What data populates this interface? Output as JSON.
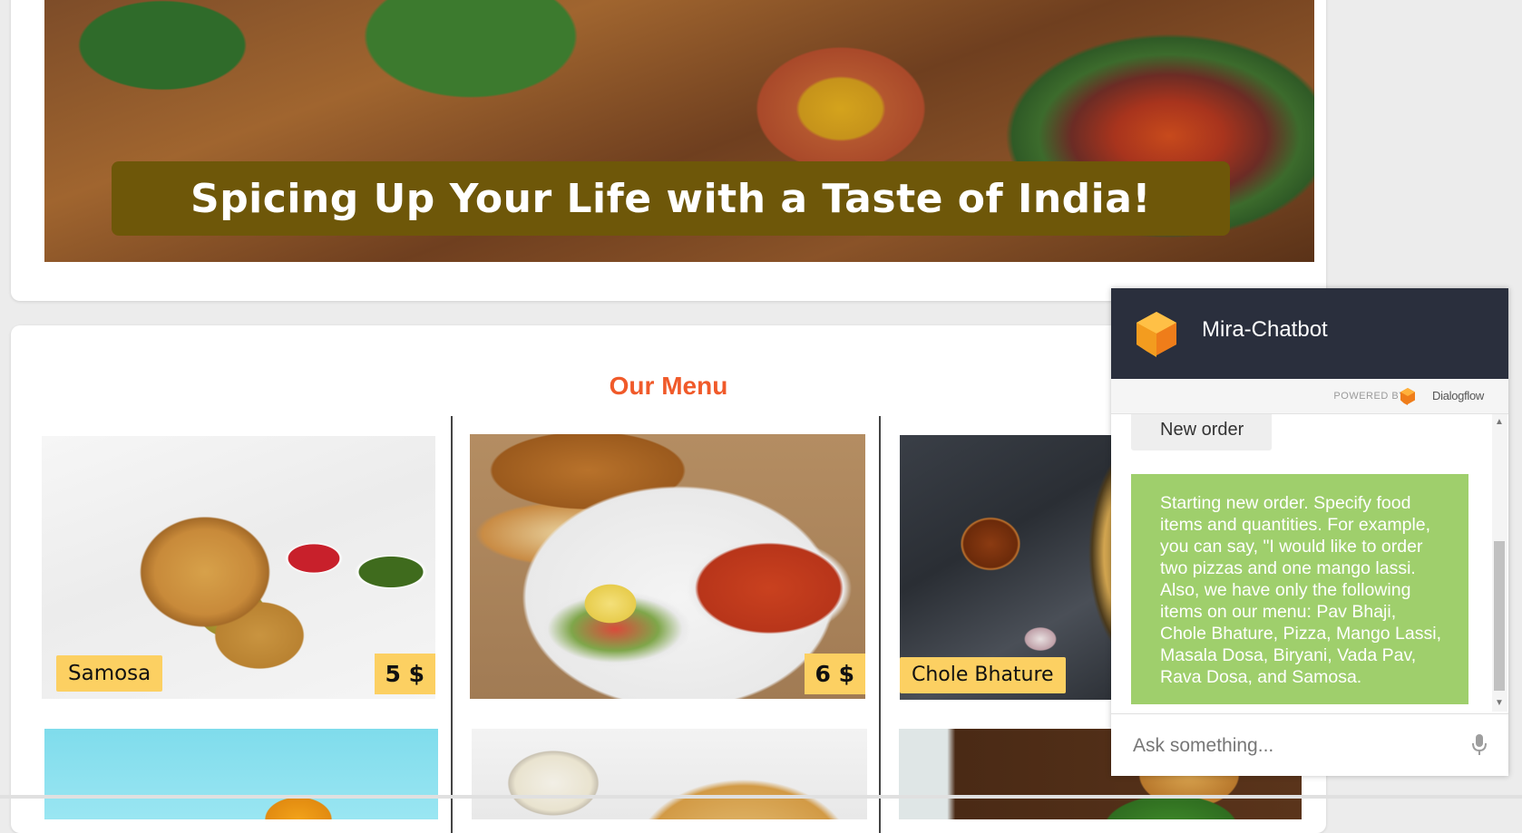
{
  "banner": {
    "caption": "Spicing Up Your Life with a Taste of India!"
  },
  "menu": {
    "title": "Our Menu",
    "items": [
      {
        "name": "Samosa",
        "price": "5 $"
      },
      {
        "name": "",
        "price": "6 $"
      },
      {
        "name": "Chole Bhature",
        "price": ""
      }
    ]
  },
  "chat": {
    "title": "Mira-Chatbot",
    "powered_by": "POWERED BY",
    "provider": "Dialogflow",
    "messages": [
      {
        "from": "user",
        "text": "New order"
      },
      {
        "from": "bot",
        "text": "Starting new order. Specify food items and quantities. For example, you can say, \"I would like to order two pizzas and one mango lassi. Also, we have only the following items on our menu: Pav Bhaji, Chole Bhature, Pizza, Mango Lassi, Masala Dosa, Biryani, Vada Pav, Rava Dosa, and Samosa."
      }
    ],
    "input_placeholder": "Ask something..."
  },
  "colors": {
    "accent": "#f05a2a",
    "label_bg": "#fcd062",
    "chat_header": "#2a2f3d",
    "bot_bubble": "#9fcf6c",
    "banner_caption_bg": "#6e5709"
  },
  "icons": [
    "dialogflow-logo-icon",
    "mic-icon",
    "scroll-up-icon",
    "scroll-down-icon"
  ]
}
